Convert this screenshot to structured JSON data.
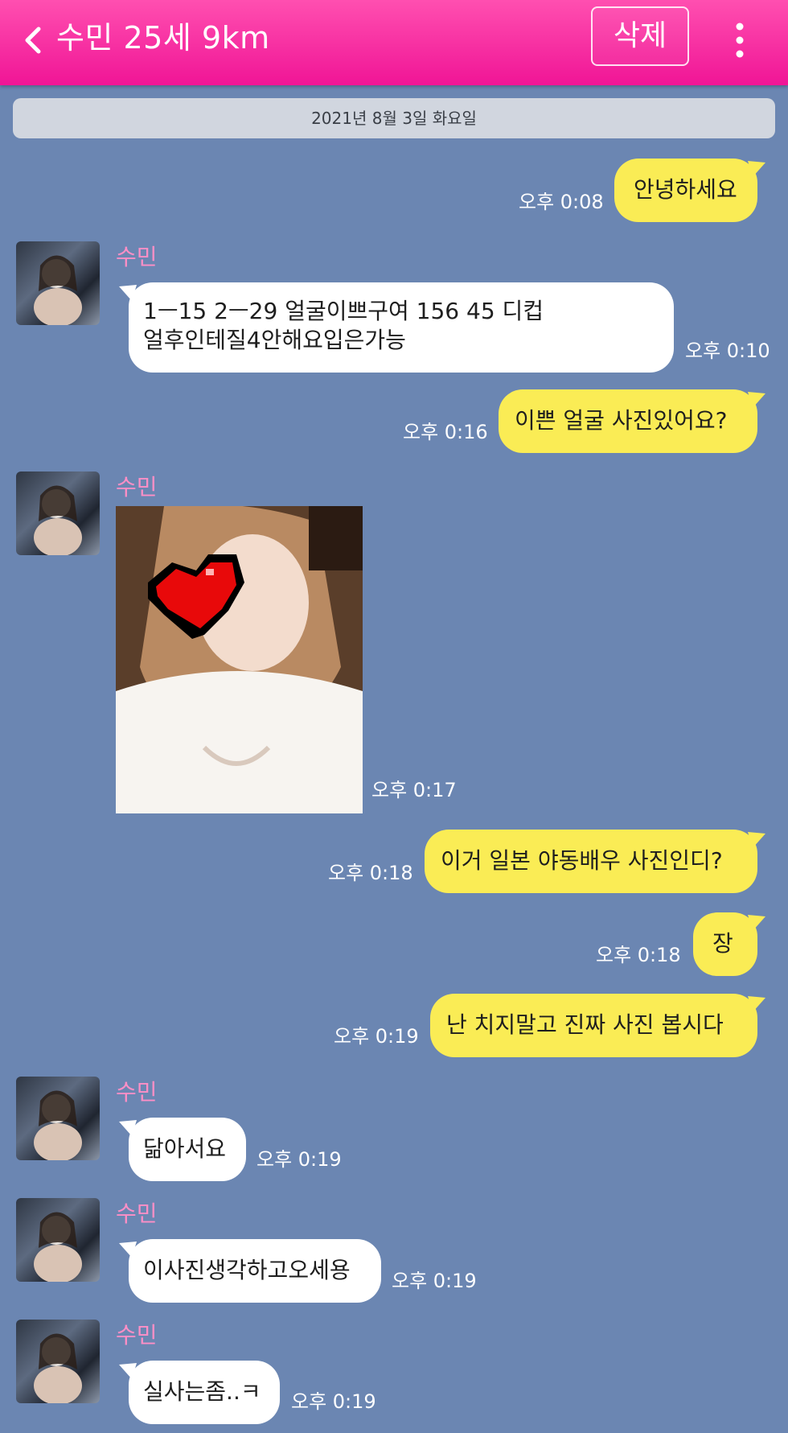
{
  "header": {
    "title": "수민 25세 9km",
    "delete_label": "삭제"
  },
  "chat": {
    "date": "2021년 8월 3일 화요일",
    "sender_name": "수민",
    "messages": [
      {
        "side": "me",
        "text": "안녕하세요",
        "time": "오후 0:08"
      },
      {
        "side": "other",
        "line1": "1ㅡ15  2ㅡ29  얼굴이쁘구여 156  45  디컵",
        "line2": "얼후인테질4안해요입은가능",
        "time": "오후 0:10"
      },
      {
        "side": "me",
        "text": "이쁜 얼굴 사진있어요?",
        "time": "오후 0:16"
      },
      {
        "side": "other",
        "type": "image",
        "time": "오후 0:17"
      },
      {
        "side": "me",
        "text": "이거 일본 야동배우 사진인디?",
        "time": "오후 0:18"
      },
      {
        "side": "me",
        "text": "장",
        "time": "오후 0:18"
      },
      {
        "side": "me",
        "text": "난 치지말고 진짜 사진 봅시다",
        "time": "오후 0:19"
      },
      {
        "side": "other",
        "text": "닮아서요",
        "time": "오후 0:19"
      },
      {
        "side": "other",
        "text": "이사진생각하고오세용",
        "time": "오후 0:19"
      },
      {
        "side": "other",
        "text": "실사는좀..ㅋ",
        "time": "오후 0:19"
      }
    ]
  },
  "colors": {
    "header": "#f01596",
    "background": "#6b86b2",
    "my_bubble": "#faec55",
    "other_bubble": "#ffffff",
    "sender_name": "#ff8fc6"
  }
}
